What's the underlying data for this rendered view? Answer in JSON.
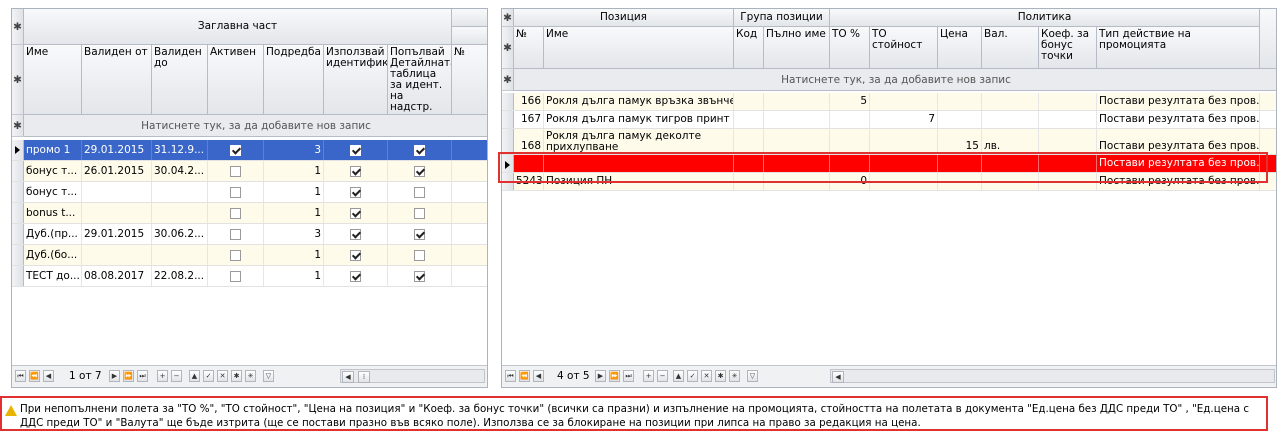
{
  "left": {
    "header_group": "Заглавна част",
    "columns": [
      "Име",
      "Валиден от",
      "Валиден до",
      "Активен",
      "Подредба",
      "Използвай идентификатора",
      "Попълвай Детайлната таблица за идент. на надстр.",
      "№"
    ],
    "new_row_hint": "Натиснете тук, за да добавите нов запис",
    "rows": [
      {
        "name": "промо 1",
        "from": "29.01.2015",
        "to": "31.12.9...",
        "active": true,
        "order": "3",
        "use_id": true,
        "fill": true,
        "selected": true
      },
      {
        "name": "бонус т...",
        "from": "26.01.2015",
        "to": "30.04.2...",
        "active": false,
        "order": "1",
        "use_id": true,
        "fill": true
      },
      {
        "name": "бонус т...",
        "from": "",
        "to": "",
        "active": false,
        "order": "1",
        "use_id": true,
        "fill": false
      },
      {
        "name": "bonus t...",
        "from": "",
        "to": "",
        "active": false,
        "order": "1",
        "use_id": true,
        "fill": false
      },
      {
        "name": "Дуб.(пр...",
        "from": "29.01.2015",
        "to": "30.06.2...",
        "active": false,
        "order": "3",
        "use_id": true,
        "fill": true
      },
      {
        "name": "Дуб.(бо...",
        "from": "",
        "to": "",
        "active": false,
        "order": "1",
        "use_id": true,
        "fill": false
      },
      {
        "name": "ТЕСТ до...",
        "from": "08.08.2017",
        "to": "22.08.2...",
        "active": false,
        "order": "1",
        "use_id": true,
        "fill": true
      }
    ],
    "nav_text": "1 от 7"
  },
  "right": {
    "group_headers": [
      "Позиция",
      "Група позиции",
      "Политика"
    ],
    "columns": [
      "№",
      "Име",
      "Код",
      "Пълно име",
      "ТО %",
      "ТО стойност",
      "Цена",
      "Вал.",
      "Коеф. за бонус точки",
      "Тип действие на промоцията"
    ],
    "new_row_hint": "Натиснете тук, за да добавите нов запис",
    "rows": [
      {
        "no": "166",
        "name": "Рокля дълга памук връзка звънчета",
        "to_pct": "5",
        "to_val": "",
        "price": "",
        "cur": "",
        "action": "Постави резултата без пров..."
      },
      {
        "no": "167",
        "name": "Рокля дълга памук тигров принт",
        "to_pct": "",
        "to_val": "7",
        "price": "",
        "cur": "",
        "action": "Постави резултата без пров..."
      },
      {
        "no": "168",
        "name": "Рокля дълга  памук деколте прихлупване",
        "to_pct": "",
        "to_val": "",
        "price": "15",
        "cur": "лв.",
        "action": "Постави резултата без пров..."
      },
      {
        "no": "",
        "name": "",
        "to_pct": "",
        "to_val": "",
        "price": "",
        "cur": "",
        "action": "Постави резултата без пров...",
        "red": true
      },
      {
        "no": "5243",
        "name": "Позиция ПН",
        "to_pct": "0",
        "to_val": "",
        "price": "",
        "cur": "",
        "action": "Постави резултата без пров..."
      }
    ],
    "nav_text": "4 от 5"
  },
  "warning": "При непопълнени полета за \"ТО %\", \"ТО стойност\", \"Цена на позиция\" и \"Коеф. за бонус точки\" (всички са празни) и изпълнение на промоцията, стойността на полетата в документа \"Ед.цена без ДДС преди ТО\" , \"Ед.цена с ДДС преди ТО\" и \"Валута\" ще бъде изтрита (ще се постави празно във всяко поле). Използва се за блокиране на позиции при липса на право за редакция на цена.",
  "colors": {
    "selected": "#3a66c9",
    "highlight": "#ff0000",
    "alt_row": "#fffbeb",
    "alert_border": "#e03030"
  }
}
